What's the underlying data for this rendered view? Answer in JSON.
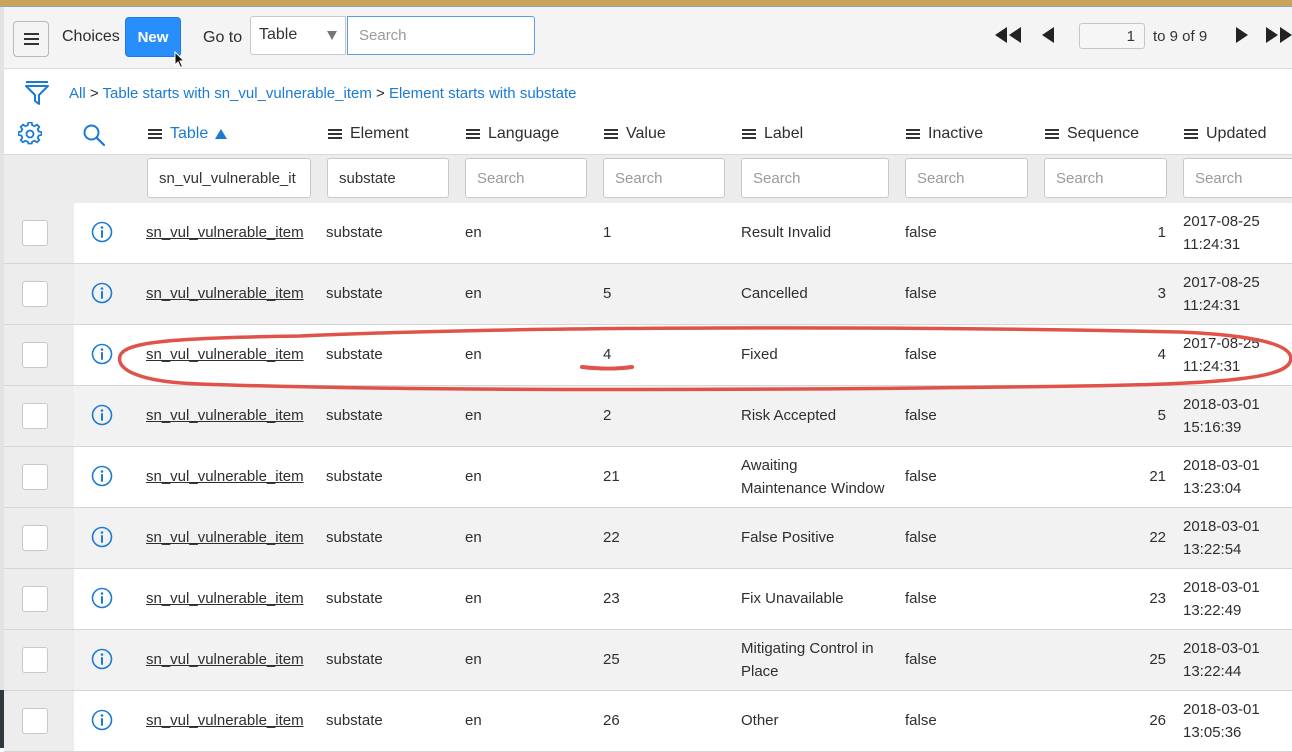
{
  "toolbar": {
    "title": "Choices",
    "new_label": "New",
    "goto_label": "Go to",
    "goto_field": "Table",
    "search_placeholder": "Search",
    "page_current": "1",
    "page_of": "to 9 of 9"
  },
  "breadcrumb": {
    "all": "All",
    "sep": ">",
    "crumb1": "Table starts with sn_vul_vulnerable_item",
    "crumb2": "Element starts with substate"
  },
  "columns": [
    "Table",
    "Element",
    "Language",
    "Value",
    "Label",
    "Inactive",
    "Sequence",
    "Updated"
  ],
  "filters": {
    "table": "sn_vul_vulnerable_it",
    "element": "substate",
    "placeholder": "Search"
  },
  "rows": [
    {
      "table": "sn_vul_vulnerable_item",
      "element": "substate",
      "language": "en",
      "value": "1",
      "label": "Result Invalid",
      "label2": "",
      "inactive": "false",
      "sequence": "1",
      "date": "2017-08-25",
      "time": "11:24:31"
    },
    {
      "table": "sn_vul_vulnerable_item",
      "element": "substate",
      "language": "en",
      "value": "5",
      "label": "Cancelled",
      "label2": "",
      "inactive": "false",
      "sequence": "3",
      "date": "2017-08-25",
      "time": "11:24:31"
    },
    {
      "table": "sn_vul_vulnerable_item",
      "element": "substate",
      "language": "en",
      "value": "4",
      "label": "Fixed",
      "label2": "",
      "inactive": "false",
      "sequence": "4",
      "date": "2017-08-25",
      "time": "11:24:31"
    },
    {
      "table": "sn_vul_vulnerable_item",
      "element": "substate",
      "language": "en",
      "value": "2",
      "label": "Risk Accepted",
      "label2": "",
      "inactive": "false",
      "sequence": "5",
      "date": "2018-03-01",
      "time": "15:16:39"
    },
    {
      "table": "sn_vul_vulnerable_item",
      "element": "substate",
      "language": "en",
      "value": "21",
      "label": "Awaiting",
      "label2": "Maintenance Window",
      "inactive": "false",
      "sequence": "21",
      "date": "2018-03-01",
      "time": "13:23:04"
    },
    {
      "table": "sn_vul_vulnerable_item",
      "element": "substate",
      "language": "en",
      "value": "22",
      "label": "False Positive",
      "label2": "",
      "inactive": "false",
      "sequence": "22",
      "date": "2018-03-01",
      "time": "13:22:54"
    },
    {
      "table": "sn_vul_vulnerable_item",
      "element": "substate",
      "language": "en",
      "value": "23",
      "label": "Fix Unavailable",
      "label2": "",
      "inactive": "false",
      "sequence": "23",
      "date": "2018-03-01",
      "time": "13:22:49"
    },
    {
      "table": "sn_vul_vulnerable_item",
      "element": "substate",
      "language": "en",
      "value": "25",
      "label": "Mitigating Control in",
      "label2": "Place",
      "inactive": "false",
      "sequence": "25",
      "date": "2018-03-01",
      "time": "13:22:44"
    },
    {
      "table": "sn_vul_vulnerable_item",
      "element": "substate",
      "language": "en",
      "value": "26",
      "label": "Other",
      "label2": "",
      "inactive": "false",
      "sequence": "26",
      "date": "2018-03-01",
      "time": "13:05:36"
    }
  ],
  "icons": {
    "menu": "hamburger-icon",
    "filter": "funnel-icon",
    "settings": "gear-icon",
    "search": "search-icon",
    "info": "info-icon",
    "first": "double-left-arrow-icon",
    "prev": "left-arrow-icon",
    "next": "right-arrow-icon",
    "last": "double-right-arrow-icon"
  },
  "colors": {
    "accent": "#278efc",
    "link": "#1a7ad6",
    "annotation": "#e0534a"
  }
}
